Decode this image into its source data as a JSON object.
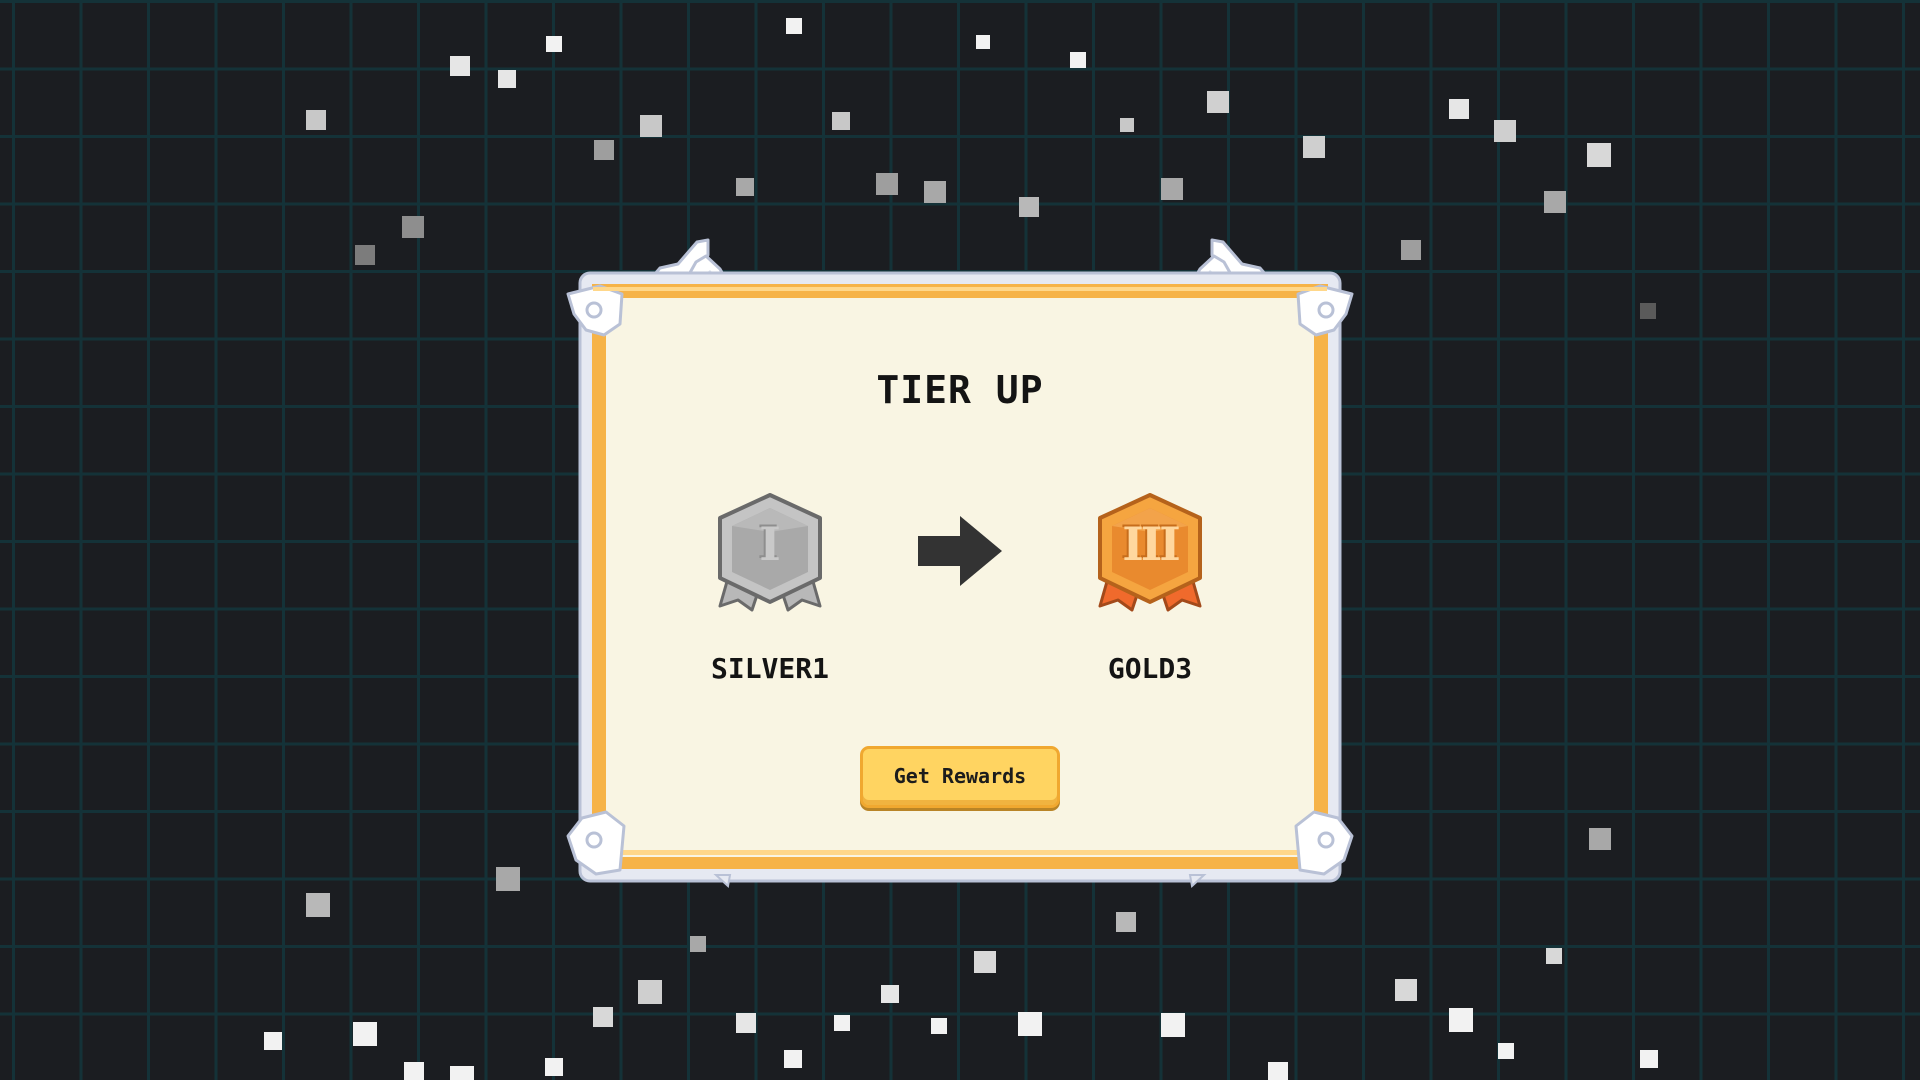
{
  "dialog": {
    "title": "TIER UP",
    "from_tier": {
      "label": "SILVER1",
      "numeral": "I",
      "icon": "silver-medal-icon"
    },
    "to_tier": {
      "label": "GOLD3",
      "numeral": "III",
      "icon": "gold-medal-icon"
    },
    "arrow_icon": "arrow-right-icon",
    "button_label": "Get Rewards"
  },
  "colors": {
    "background": "#1b1d21",
    "grid_line": "#143238",
    "panel_fill": "#f9f5e3",
    "panel_border": "#f6b348",
    "panel_border_light": "#ffd78a",
    "frame_silver": "#e6e9f2",
    "silver_badge": "#b2b2b2",
    "gold_badge": "#f2a03e",
    "gold_ribbon": "#f06a2c",
    "button_fill": "#ffd461",
    "text_dark": "#141414"
  }
}
